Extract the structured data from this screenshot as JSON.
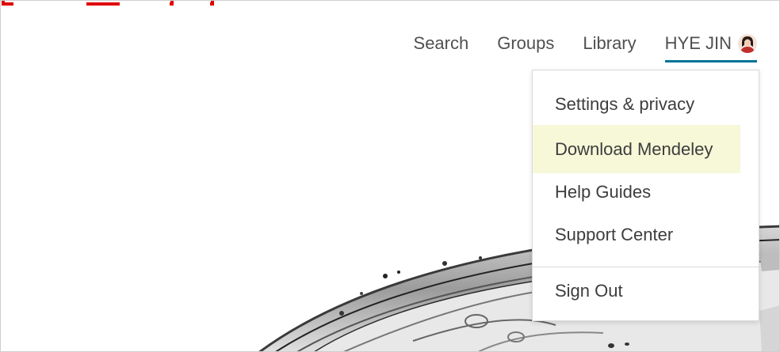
{
  "nav": {
    "search": "Search",
    "groups": "Groups",
    "library": "Library",
    "user": "HYE JIN"
  },
  "user_menu": {
    "items": [
      {
        "label": "Settings & privacy"
      },
      {
        "label": "Download Mendeley"
      },
      {
        "label": "Help Guides"
      },
      {
        "label": "Support Center"
      },
      {
        "label": "Sign Out"
      }
    ],
    "highlighted_index": 1
  },
  "colors": {
    "accent_underline": "#007398",
    "highlight": "#f6f8d8",
    "annotation": "#e00000"
  }
}
